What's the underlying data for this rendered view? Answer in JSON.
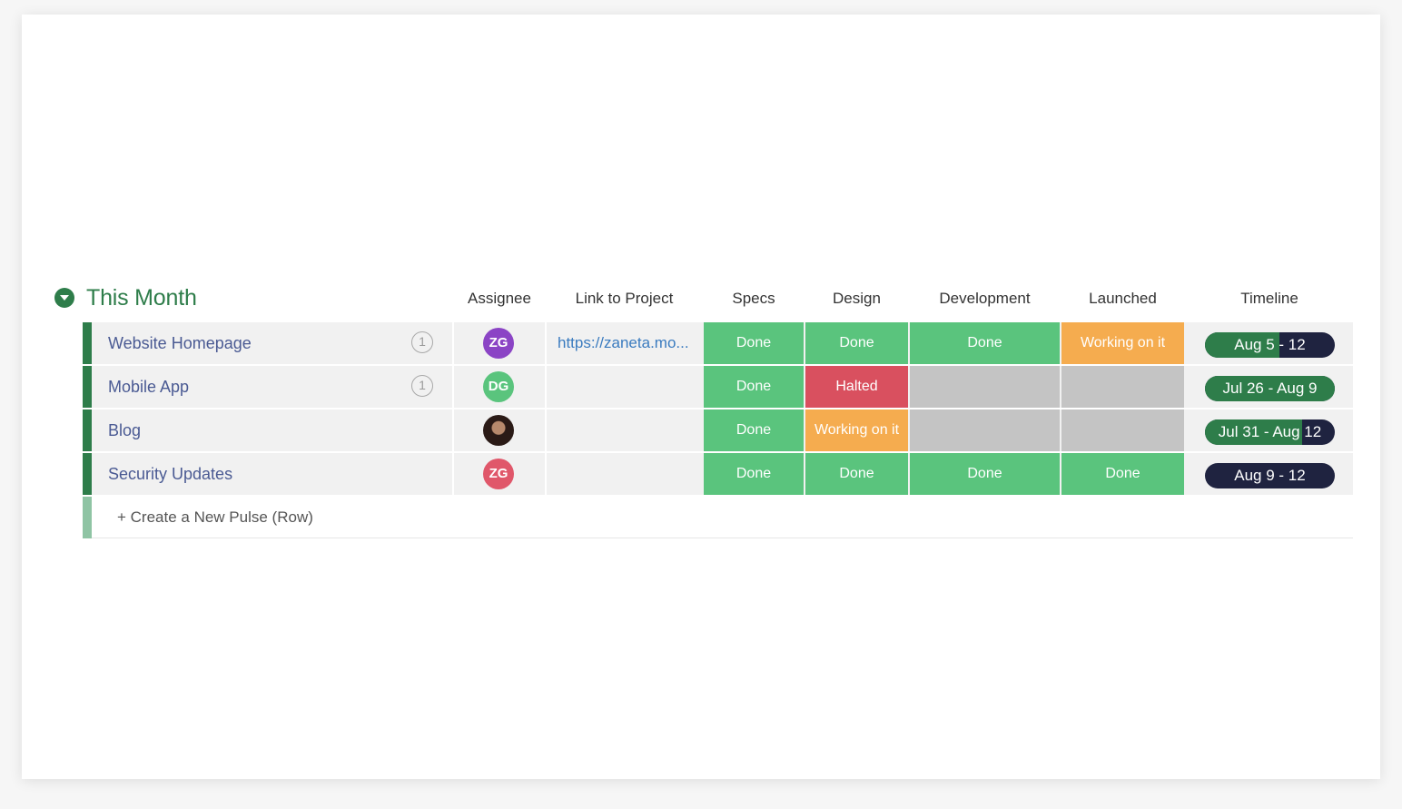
{
  "group": {
    "title": "This Month",
    "color": "#2e7d4a",
    "collapse_icon": "chevron-down-icon"
  },
  "columns": {
    "assignee": "Assignee",
    "link": "Link to Project",
    "specs": "Specs",
    "design": "Design",
    "development": "Development",
    "launched": "Launched",
    "timeline": "Timeline"
  },
  "status_colors": {
    "Done": "#5ac47d",
    "Working on it": "#f5ac4f",
    "Halted": "#d9505f",
    "empty": "#c4c4c4"
  },
  "rows": [
    {
      "name": "Website Homepage",
      "updates": "1",
      "assignee": {
        "initials": "ZG",
        "color": "#8b44c5"
      },
      "link": "https://zaneta.mo...",
      "specs": "Done",
      "design": "Done",
      "development": "Done",
      "launched": "Working on it",
      "timeline": {
        "label": "Aug 5 - 12",
        "progress": 0.57
      }
    },
    {
      "name": "Mobile App",
      "updates": "1",
      "assignee": {
        "initials": "DG",
        "color": "#5ac47d"
      },
      "link": "",
      "specs": "Done",
      "design": "Halted",
      "development": "",
      "launched": "",
      "timeline": {
        "label": "Jul 26 - Aug 9",
        "progress": 1.0
      }
    },
    {
      "name": "Blog",
      "updates": "",
      "assignee": {
        "initials": "",
        "color": "#2a1a16",
        "photo": true
      },
      "link": "",
      "specs": "Done",
      "design": "Working on it",
      "development": "",
      "launched": "",
      "timeline": {
        "label": "Jul 31 - Aug 12",
        "progress": 0.75
      }
    },
    {
      "name": "Security Updates",
      "updates": "",
      "assignee": {
        "initials": "ZG",
        "color": "#e0576a"
      },
      "link": "",
      "specs": "Done",
      "design": "Done",
      "development": "Done",
      "launched": "Done",
      "timeline": {
        "label": "Aug 9 - 12",
        "progress": 0.0
      }
    }
  ],
  "new_row_label": "+ Create a New Pulse (Row)"
}
